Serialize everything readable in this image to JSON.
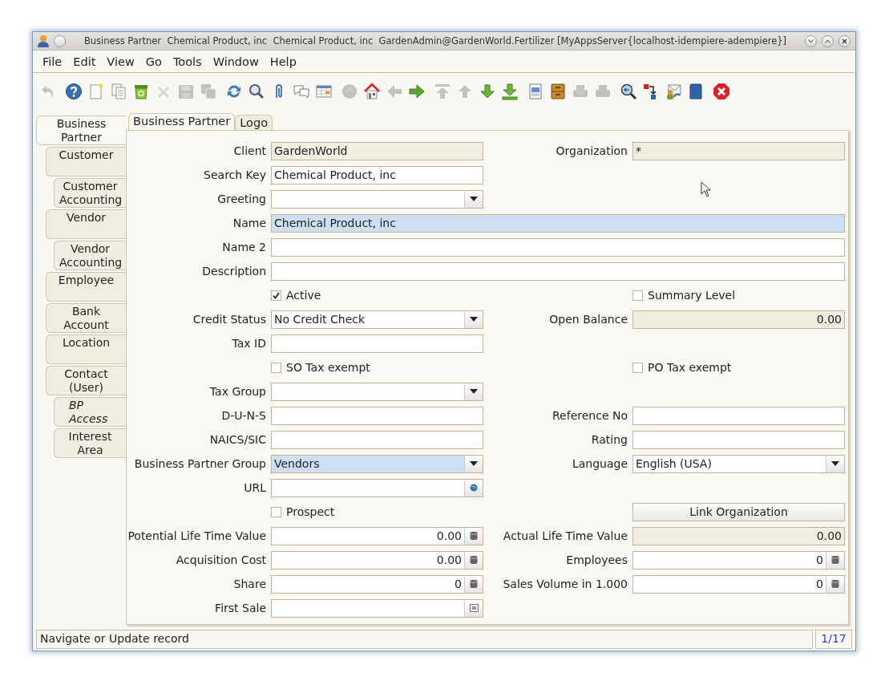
{
  "window": {
    "title": "Business Partner  Chemical Product, inc  Chemical Product, inc  GardenAdmin@GardenWorld.Fertilizer [MyAppsServer{localhost-idempiere-adempiere}]"
  },
  "menu": [
    "File",
    "Edit",
    "View",
    "Go",
    "Tools",
    "Window",
    "Help"
  ],
  "toolbar": [
    {
      "buttons": [
        {
          "kind": "undo",
          "disabled": true
        }
      ]
    },
    {
      "buttons": [
        {
          "kind": "help",
          "disabled": false
        },
        {
          "kind": "new",
          "disabled": false
        },
        {
          "kind": "copy",
          "disabled": false
        },
        {
          "kind": "recycle",
          "disabled": false
        },
        {
          "kind": "delete",
          "disabled": true
        },
        {
          "kind": "save",
          "disabled": true
        },
        {
          "kind": "saveall",
          "disabled": true
        }
      ]
    },
    {
      "buttons": [
        {
          "kind": "refresh",
          "disabled": false
        },
        {
          "kind": "find",
          "disabled": false
        },
        {
          "kind": "attach",
          "disabled": false
        },
        {
          "kind": "chat",
          "disabled": false
        },
        {
          "kind": "grid",
          "disabled": false
        }
      ]
    },
    {
      "buttons": [
        {
          "kind": "history",
          "disabled": true
        },
        {
          "kind": "home",
          "disabled": false
        },
        {
          "kind": "back",
          "disabled": true
        },
        {
          "kind": "forward",
          "disabled": false
        }
      ]
    },
    {
      "buttons": [
        {
          "kind": "first",
          "disabled": true
        },
        {
          "kind": "up",
          "disabled": true
        },
        {
          "kind": "down",
          "disabled": false
        },
        {
          "kind": "last",
          "disabled": false
        }
      ]
    },
    {
      "buttons": [
        {
          "kind": "report",
          "disabled": false
        },
        {
          "kind": "archive",
          "disabled": false
        },
        {
          "kind": "preview",
          "disabled": true
        },
        {
          "kind": "print",
          "disabled": true
        }
      ]
    },
    {
      "buttons": [
        {
          "kind": "zoom",
          "disabled": false
        },
        {
          "kind": "workflow",
          "disabled": false
        },
        {
          "kind": "info",
          "disabled": false
        },
        {
          "kind": "square",
          "disabled": false
        }
      ]
    },
    {
      "buttons": [
        {
          "kind": "exit",
          "disabled": false
        }
      ]
    }
  ],
  "side_tabs": [
    {
      "label": "Business Partner",
      "selected": true,
      "read_only": false,
      "children": [
        {
          "label": "Customer",
          "selected": false,
          "read_only": false,
          "children": [
            {
              "label": "Customer Accounting",
              "selected": false,
              "read_only": false
            }
          ]
        },
        {
          "label": "Vendor",
          "selected": false,
          "read_only": false,
          "children": [
            {
              "label": "Vendor Accounting",
              "selected": false,
              "read_only": false
            }
          ]
        },
        {
          "label": "Employee",
          "selected": false,
          "read_only": false
        },
        {
          "label": "Bank Account",
          "selected": false,
          "read_only": false
        },
        {
          "label": "Location",
          "selected": false,
          "read_only": false
        },
        {
          "label": "Contact (User)",
          "selected": false,
          "read_only": false,
          "children": [
            {
              "label": "BP Access",
              "selected": false,
              "read_only": true
            },
            {
              "label": "Interest Area",
              "selected": false,
              "read_only": false
            }
          ]
        }
      ]
    }
  ],
  "tabs": [
    {
      "label": "Business Partner",
      "selected": true
    },
    {
      "label": "Logo",
      "selected": false
    }
  ],
  "form": {
    "rows": [
      {
        "left": {
          "kind": "text",
          "label": "Client",
          "value": "GardenWorld",
          "readonly": true,
          "mandatory": false
        },
        "right": {
          "kind": "text",
          "label": "Organization",
          "value": "*",
          "readonly": true,
          "mandatory": false
        }
      },
      {
        "left": {
          "kind": "text",
          "label": "Search Key",
          "value": "Chemical Product, inc",
          "readonly": false,
          "mandatory": false
        }
      },
      {
        "left": {
          "kind": "combo",
          "label": "Greeting",
          "readonly": false,
          "mandatory": false
        }
      },
      {
        "wide": {
          "kind": "text",
          "label": "Name",
          "value": "Chemical Product, inc",
          "readonly": false,
          "mandatory": true
        }
      },
      {
        "wide": {
          "kind": "text",
          "label": "Name 2",
          "readonly": false,
          "mandatory": false
        }
      },
      {
        "wide": {
          "kind": "text",
          "label": "Description",
          "readonly": false,
          "mandatory": false
        }
      },
      {
        "left": {
          "kind": "checkbox",
          "label": "Active",
          "checked": true
        },
        "right": {
          "kind": "checkbox",
          "label": "Summary Level",
          "checked": false
        }
      },
      {
        "left": {
          "kind": "combo",
          "label": "Credit Status",
          "value": "No Credit Check",
          "readonly": false,
          "mandatory": false
        },
        "right": {
          "kind": "amount",
          "label": "Open Balance",
          "value": "0.00",
          "readonly": true,
          "mandatory": false
        }
      },
      {
        "left": {
          "kind": "text",
          "label": "Tax ID",
          "readonly": false,
          "mandatory": false
        }
      },
      {
        "left": {
          "kind": "checkbox",
          "label": "SO Tax exempt",
          "checked": false
        },
        "right": {
          "kind": "checkbox",
          "label": "PO Tax exempt",
          "checked": false
        }
      },
      {
        "left": {
          "kind": "combo",
          "label": "Tax Group",
          "readonly": false,
          "mandatory": false
        }
      },
      {
        "left": {
          "kind": "text",
          "label": "D-U-N-S",
          "readonly": false,
          "mandatory": false
        },
        "right": {
          "kind": "text",
          "label": "Reference No",
          "readonly": false,
          "mandatory": false
        }
      },
      {
        "left": {
          "kind": "text",
          "label": "NAICS/SIC",
          "readonly": false,
          "mandatory": false
        },
        "right": {
          "kind": "text",
          "label": "Rating",
          "readonly": false,
          "mandatory": false
        }
      },
      {
        "left": {
          "kind": "combo",
          "label": "Business Partner Group",
          "value": "Vendors",
          "readonly": false,
          "mandatory": true
        },
        "right": {
          "kind": "combo",
          "label": "Language",
          "value": "English (USA)",
          "readonly": false,
          "mandatory": false
        }
      },
      {
        "left": {
          "kind": "url",
          "label": "URL",
          "readonly": false,
          "mandatory": false
        }
      },
      {
        "left": {
          "kind": "checkbox",
          "label": "Prospect",
          "checked": false
        },
        "right": {
          "kind": "button",
          "label": "Link Organization"
        }
      },
      {
        "left": {
          "kind": "number",
          "label": "Potential Life Time Value",
          "value": "0.00",
          "readonly": false,
          "mandatory": false
        },
        "right": {
          "kind": "amount",
          "label": "Actual Life Time Value",
          "value": "0.00",
          "readonly": true,
          "mandatory": false
        }
      },
      {
        "left": {
          "kind": "number",
          "label": "Acquisition Cost",
          "value": "0.00",
          "readonly": false,
          "mandatory": false
        },
        "right": {
          "kind": "number",
          "label": "Employees",
          "value": "0",
          "readonly": false,
          "mandatory": false
        }
      },
      {
        "left": {
          "kind": "number",
          "label": "Share",
          "value": "0",
          "readonly": false,
          "mandatory": false
        },
        "right": {
          "kind": "number",
          "label": "Sales Volume in 1.000",
          "value": "0",
          "readonly": false,
          "mandatory": false
        }
      },
      {
        "left": {
          "kind": "date",
          "label": "First Sale",
          "readonly": false,
          "mandatory": false
        }
      }
    ]
  },
  "status_bar": {
    "message": "Navigate or Update record",
    "record": "1/17"
  }
}
